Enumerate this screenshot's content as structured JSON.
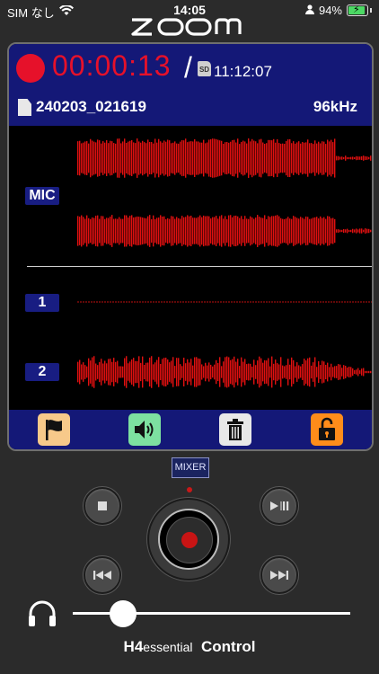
{
  "status_bar": {
    "carrier": "SIM なし",
    "time": "14:05",
    "battery": "94%",
    "battery_level": 0.94
  },
  "logo": "ZOOM",
  "recorder": {
    "elapsed_time": "00:00:13",
    "remaining_time": "11:12:07",
    "sd_label": "SD",
    "filename": "240203_021619",
    "sample_rate": "96kHz"
  },
  "tracks": {
    "mic_label": "MIC",
    "track1_label": "1",
    "track2_label": "2"
  },
  "toolbar": {
    "mark": "flag-icon",
    "speaker": "speaker-icon",
    "delete": "trash-icon",
    "lock": "unlock-icon"
  },
  "transport": {
    "mixer_label": "MIXER",
    "stop": "stop-icon",
    "play_pause": "play-pause-icon",
    "rewind": "rewind-icon",
    "fast_forward": "fast-forward-icon"
  },
  "monitor": {
    "volume_level": 0.14
  },
  "brand": {
    "model": "H4",
    "edition": "essential",
    "product": "Control"
  },
  "colors": {
    "accent_red": "#e6112a",
    "panel_blue": "#141877",
    "label_blue": "#181d82",
    "wave_red": "#e01010"
  }
}
